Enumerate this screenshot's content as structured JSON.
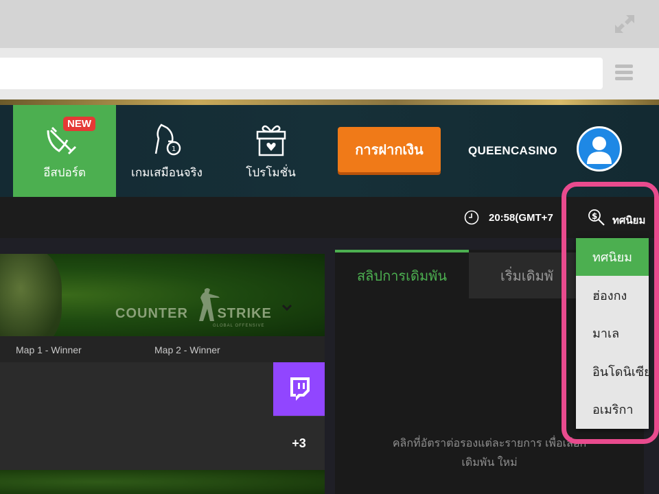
{
  "header": {
    "nav": [
      {
        "label": "อีสปอร์ต",
        "badge": "NEW",
        "icon": "esports-sword-shield-icon",
        "active": true
      },
      {
        "label": "เกมเสมือนจริง",
        "icon": "virtual-horse-icon",
        "active": false
      },
      {
        "label": "โปรโมชั่น",
        "icon": "gift-icon",
        "active": false
      }
    ],
    "deposit_label": "การฝากเงิน",
    "username": "QUEENCASINO",
    "accent": "#4caf50",
    "deposit_color": "#f07a18"
  },
  "subbar": {
    "time": "20:58(GMT+7",
    "odds_format": "ทศนิยม"
  },
  "match": {
    "game_logo_text": "COUNTER",
    "game_logo_text2": "STRIKE",
    "game_logo_sub": "GLOBAL OFFENSIVE",
    "markets": [
      "Map 1 - Winner",
      "Map 2 - Winner"
    ],
    "more_count": "+3"
  },
  "betslip": {
    "tabs": [
      "สลิปการเดิมพัน",
      "เริ่มเดิมพั"
    ],
    "message_line1": "คลิกที่อัตราต่อรองแต่ละรายการ เพื่อเลือก",
    "message_line2": "เดิมพัน ใหม่"
  },
  "odds_dropdown": {
    "options": [
      "ทศนิยม",
      "ฮ่องกง",
      "มาเล",
      "อินโดนิเซีย",
      "อเมริกา"
    ],
    "selected": "ทศนิยม",
    "highlight_color": "#e94b8e"
  }
}
